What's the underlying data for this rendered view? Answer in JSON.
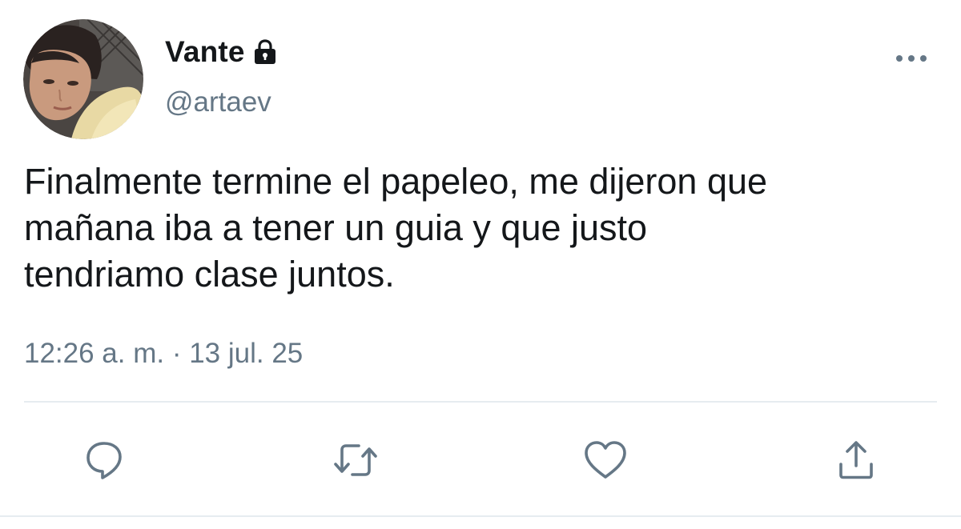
{
  "user": {
    "display_name": "Vante",
    "handle": "@artaev",
    "protected": true
  },
  "tweet": {
    "text": "Finalmente termine el papeleo, me dijeron que\nmañana iba a tener un guia y que justo\ntendriamo clase juntos.",
    "timestamp": "12:26 a. m. · 13 jul. 25"
  },
  "icons": {
    "more": "more-dots-icon",
    "lock": "lock-icon",
    "reply": "reply-bubble-icon",
    "retweet": "retweet-icon",
    "like": "heart-icon",
    "share": "share-upload-icon"
  },
  "colors": {
    "text_primary": "#14171a",
    "text_secondary": "#657786",
    "icon_gray": "#657786",
    "divider": "#e6ecf0"
  }
}
